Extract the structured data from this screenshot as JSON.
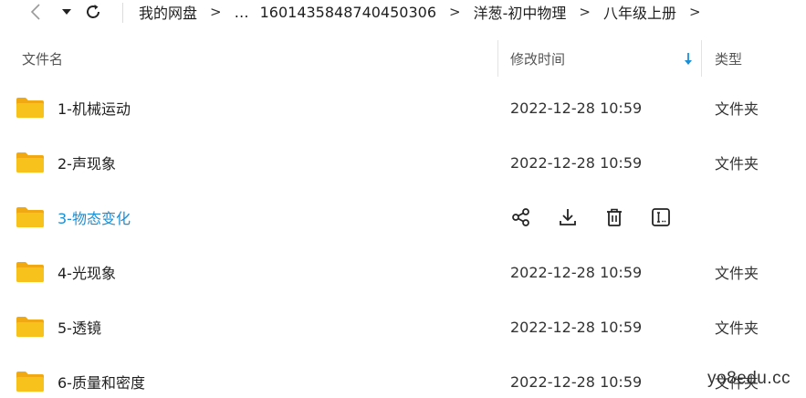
{
  "navigation": {
    "back_icon": "chevron-left-icon",
    "history_icon": "caret-down-icon",
    "refresh_icon": "refresh-icon"
  },
  "breadcrumb": {
    "items": [
      "我的网盘",
      "…",
      "1601435848740450306",
      "洋葱-初中物理",
      "八年级上册"
    ],
    "separator": ">"
  },
  "columns": {
    "name": "文件名",
    "modified": "修改时间",
    "type": "类型",
    "sort_icon": "arrow-down-icon"
  },
  "colors": {
    "folder": "#f7c21b",
    "folder_back": "#f0a913",
    "accent": "#1a8fd6",
    "text": "#1f1f1f"
  },
  "files": [
    {
      "name": "1-机械运动",
      "modified": "2022-12-28 10:59",
      "type": "文件夹"
    },
    {
      "name": "2-声现象",
      "modified": "2022-12-28 10:59",
      "type": "文件夹"
    },
    {
      "name": "3-物态变化",
      "modified": "",
      "type": ""
    },
    {
      "name": "4-光现象",
      "modified": "2022-12-28 10:59",
      "type": "文件夹"
    },
    {
      "name": "5-透镜",
      "modified": "2022-12-28 10:59",
      "type": "文件夹"
    },
    {
      "name": "6-质量和密度",
      "modified": "2022-12-28 10:59",
      "type": "文件夹"
    }
  ],
  "hover_actions": [
    "share-icon",
    "download-icon",
    "delete-icon",
    "rename-icon"
  ],
  "watermark": "yo8edu.cc"
}
